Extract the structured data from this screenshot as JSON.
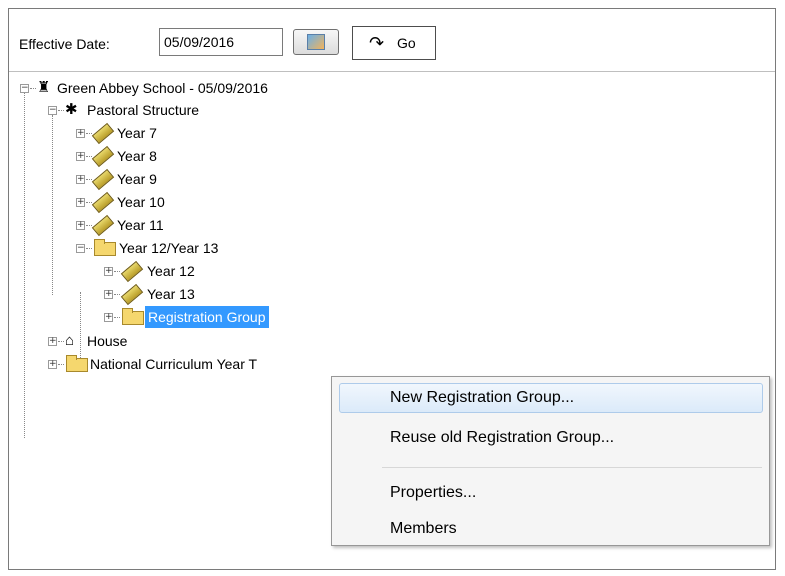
{
  "toolbar": {
    "effective_date_label": "Effective Date:",
    "effective_date_value": "05/09/2016",
    "go_label": "Go",
    "calendar_icon": "calendar-icon",
    "go_icon": "redo-arrow-icon"
  },
  "tree": {
    "root": "Green Abbey School - 05/09/2016",
    "pastoral": "Pastoral Structure",
    "year7": "Year  7",
    "year8": "Year  8",
    "year9": "Year  9",
    "year10": "Year 10",
    "year11": "Year 11",
    "year1213": "Year 12/Year 13",
    "year12": "Year 12",
    "year13": "Year 13",
    "reg_group": "Registration Group",
    "house": "House",
    "ncy": "National Curriculum Year T"
  },
  "context_menu": {
    "items": [
      "New Registration Group...",
      "Reuse old Registration Group...",
      "Properties...",
      "Members"
    ],
    "highlighted": "New Registration Group..."
  },
  "colors": {
    "selection": "#3399ff",
    "menu_highlight": "#dbeaf9"
  }
}
